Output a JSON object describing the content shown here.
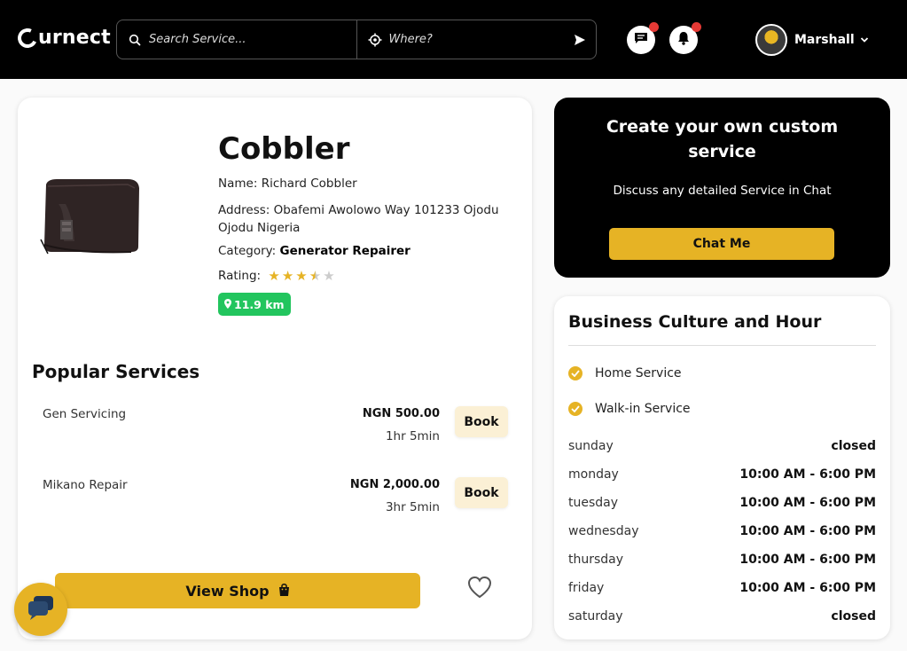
{
  "header": {
    "logo_text": "urnect",
    "search_placeholder": "Search Service...",
    "location_placeholder": "Where?",
    "user_name": "Marshall"
  },
  "listing": {
    "title": "Cobbler",
    "name_label": "Name:",
    "name_value": "Richard Cobbler",
    "address_label": "Address:",
    "address_value": "Obafemi Awolowo Way 101233 Ojodu Ojodu Nigeria",
    "category_label": "Category:",
    "category_value": "Generator Repairer",
    "rating_label": "Rating:",
    "rating": 3.5,
    "rating_max": 5,
    "distance": "11.9 km"
  },
  "popular": {
    "title": "Popular Services",
    "services": [
      {
        "name": "Gen Servicing",
        "price": "NGN 500.00",
        "duration": "1hr 5min",
        "book_label": "Book"
      },
      {
        "name": "Mikano Repair",
        "price": "NGN 2,000.00",
        "duration": "3hr 5min",
        "book_label": "Book"
      }
    ],
    "view_shop_label": "View Shop"
  },
  "cta": {
    "title": "Create your own custom service",
    "subtitle": "Discuss any detailed Service in Chat",
    "button_label": "Chat Me"
  },
  "hours": {
    "title": "Business Culture and Hour",
    "features": [
      "Home Service",
      "Walk-in Service"
    ],
    "schedule": [
      {
        "day": "sunday",
        "hours": "closed"
      },
      {
        "day": "monday",
        "hours": "10:00 AM - 6:00 PM"
      },
      {
        "day": "tuesday",
        "hours": "10:00 AM - 6:00 PM"
      },
      {
        "day": "wednesday",
        "hours": "10:00 AM - 6:00 PM"
      },
      {
        "day": "thursday",
        "hours": "10:00 AM - 6:00 PM"
      },
      {
        "day": "friday",
        "hours": "10:00 AM - 6:00 PM"
      },
      {
        "day": "saturday",
        "hours": "closed"
      }
    ]
  },
  "colors": {
    "accent": "#e6b325",
    "badge_green": "#22c55e",
    "notification_dot": "#e53935",
    "header_bg": "#000000"
  },
  "icons": {
    "search": "search-icon",
    "location": "crosshair-icon",
    "send": "send-icon",
    "messages": "chat-bubble-icon",
    "notifications": "bell-icon",
    "shop": "shopping-bag-icon",
    "favorite": "heart-icon",
    "support": "chat-icon"
  }
}
